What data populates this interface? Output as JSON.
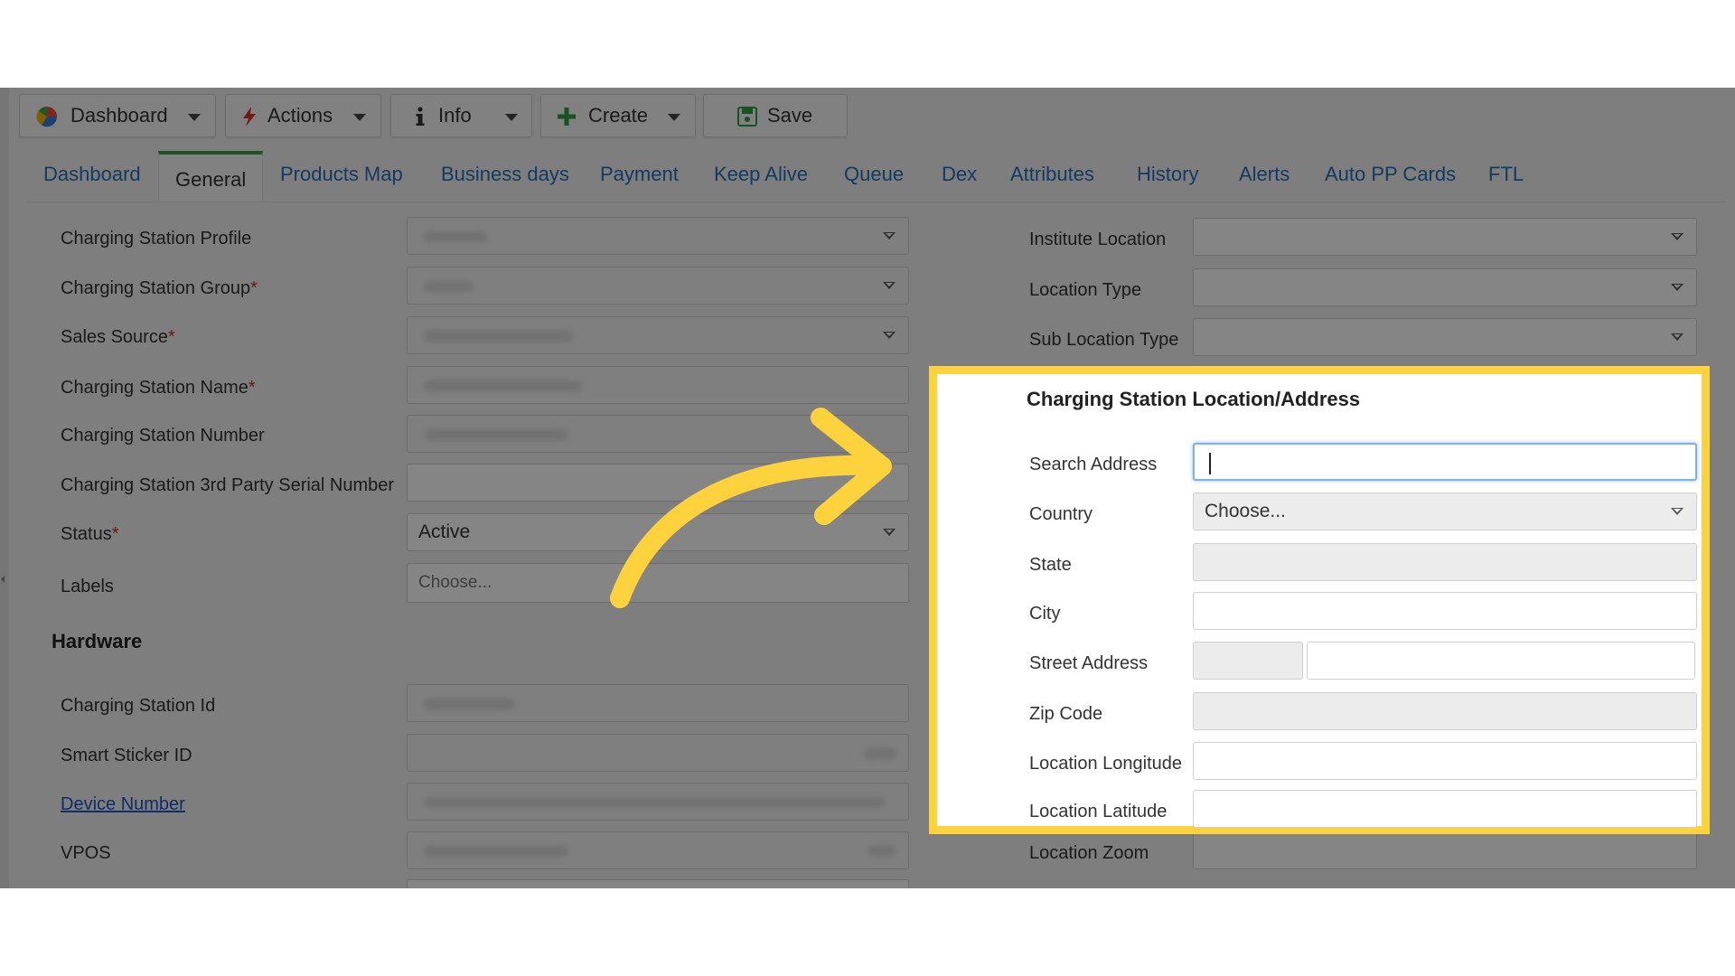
{
  "toolbar": {
    "dashboard_label": "Dashboard",
    "actions_label": "Actions",
    "info_label": "Info",
    "create_label": "Create",
    "save_label": "Save"
  },
  "tabs": [
    {
      "label": "Dashboard"
    },
    {
      "label": "General"
    },
    {
      "label": "Products Map"
    },
    {
      "label": "Business days"
    },
    {
      "label": "Payment"
    },
    {
      "label": "Keep Alive"
    },
    {
      "label": "Queue"
    },
    {
      "label": "Dex"
    },
    {
      "label": "Attributes"
    },
    {
      "label": "History"
    },
    {
      "label": "Alerts"
    },
    {
      "label": "Auto PP Cards"
    },
    {
      "label": "FTL"
    }
  ],
  "general": {
    "profile_label": "Charging Station Profile",
    "group_label": "Charging Station Group",
    "sales_source_label": "Sales Source",
    "name_label": "Charging Station Name",
    "number_label": "Charging Station Number",
    "serial_label": "Charging Station 3rd Party Serial Number",
    "status_label": "Status",
    "status_value": "Active",
    "labels_label": "Labels",
    "labels_placeholder": "Choose...",
    "required_mark": "*"
  },
  "hardware": {
    "title": "Hardware",
    "station_id_label": "Charging Station Id",
    "smart_sticker_label": "Smart Sticker ID",
    "device_number_label": "Device Number",
    "vpos_label": "VPOS"
  },
  "location": {
    "institute_location_label": "Institute Location",
    "location_type_label": "Location Type",
    "sub_location_type_label": "Sub Location Type",
    "section_title": "Charging Station Location/Address",
    "search_address_label": "Search Address",
    "country_label": "Country",
    "country_placeholder": "Choose...",
    "state_label": "State",
    "city_label": "City",
    "street_address_label": "Street Address",
    "zip_code_label": "Zip Code",
    "longitude_label": "Location Longitude",
    "latitude_label": "Location Latitude",
    "zoom_label": "Location Zoom"
  },
  "colors": {
    "highlight_border": "#fdd23c",
    "active_tab_accent": "#3a9e4b",
    "link": "#2a6fb6",
    "arrow": "#fdd23c"
  }
}
